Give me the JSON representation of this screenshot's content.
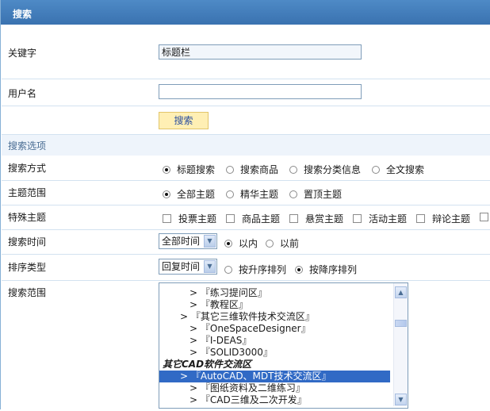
{
  "header": {
    "title": "搜索"
  },
  "keyword": {
    "label": "关键字",
    "value": "标题栏"
  },
  "username": {
    "label": "用户名",
    "value": ""
  },
  "search_button": "搜索",
  "options_section": "搜索选项",
  "search_mode": {
    "label": "搜索方式",
    "options": [
      "标题搜索",
      "搜索商品",
      "搜索分类信息",
      "全文搜索"
    ],
    "selected": "标题搜索"
  },
  "topic_scope": {
    "label": "主题范围",
    "options": [
      "全部主题",
      "精华主题",
      "置顶主题"
    ],
    "selected": "全部主题"
  },
  "special_topics": {
    "label": "特殊主题",
    "options": [
      "投票主题",
      "商品主题",
      "悬赏主题",
      "活动主题",
      "辩论主题"
    ]
  },
  "search_time": {
    "label": "搜索时间",
    "select_value": "全部时间",
    "options": [
      "以内",
      "以前"
    ],
    "selected": "以内"
  },
  "sort_type": {
    "label": "排序类型",
    "select_value": "回复时间",
    "options": [
      "按升序排列",
      "按降序排列"
    ],
    "selected": "按降序排列"
  },
  "search_range": {
    "label": "搜索范围",
    "items": [
      {
        "text": "> 『练习提问区』",
        "level": 2
      },
      {
        "text": "> 『教程区』",
        "level": 2
      },
      {
        "text": "> 『其它三维软件技术交流区』",
        "level": 1
      },
      {
        "text": "> 『OneSpaceDesigner』",
        "level": 2
      },
      {
        "text": "> 『I-DEAS』",
        "level": 2
      },
      {
        "text": "> 『SOLID3000』",
        "level": 2
      },
      {
        "text": "其它CAD软件交流区",
        "level": 0,
        "group": true
      },
      {
        "text": "> 『AutoCAD、MDT技术交流区』",
        "level": 1,
        "selected": true
      },
      {
        "text": "> 『图纸资料及二维练习』",
        "level": 2
      },
      {
        "text": "> 『CAD三维及二次开发』",
        "level": 2
      }
    ]
  },
  "colors": {
    "header": "#3f78b6",
    "selection": "#316ac5",
    "button_bg": "#ffefb4"
  }
}
